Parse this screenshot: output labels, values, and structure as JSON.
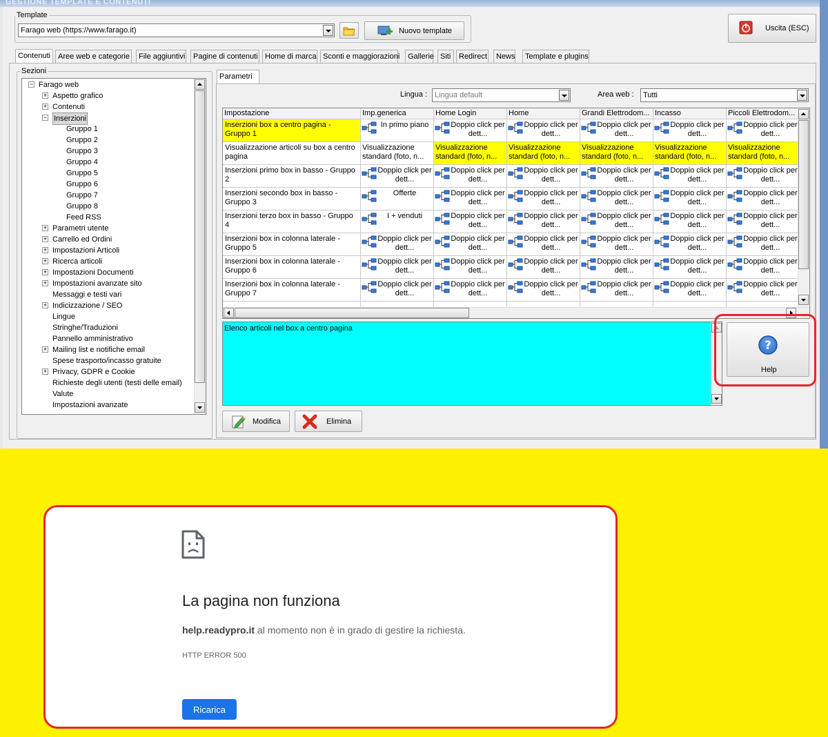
{
  "window": {
    "title": "GESTIONE TEMPLATE E CONTENUTI"
  },
  "template": {
    "group_label": "Template",
    "selected": "Farago web (https://www.farago.it)",
    "new_button": "Nuovo template",
    "exit_button": "Uscita (ESC)"
  },
  "tabs": [
    "Contenuti",
    "Aree web e categorie",
    "File aggiuntivi",
    "Pagine di contenuti",
    "Home di marca",
    "Sconti e maggiorazioni",
    "Gallerie",
    "Siti",
    "Redirect",
    "News",
    "Template e plugins"
  ],
  "sections": {
    "label": "Sezioni",
    "tree": [
      {
        "label": "Farago web",
        "level": 0,
        "expander": "−"
      },
      {
        "label": "Aspetto grafico",
        "level": 1,
        "expander": "+"
      },
      {
        "label": "Contenuti",
        "level": 1,
        "expander": "+"
      },
      {
        "label": "Inserzioni",
        "level": 1,
        "expander": "−",
        "selected": true
      },
      {
        "label": "Gruppo 1",
        "level": 2
      },
      {
        "label": "Gruppo 2",
        "level": 2
      },
      {
        "label": "Gruppo 3",
        "level": 2
      },
      {
        "label": "Gruppo 4",
        "level": 2
      },
      {
        "label": "Gruppo 5",
        "level": 2
      },
      {
        "label": "Gruppo 6",
        "level": 2
      },
      {
        "label": "Gruppo 7",
        "level": 2
      },
      {
        "label": "Gruppo 8",
        "level": 2
      },
      {
        "label": "Feed RSS",
        "level": 2
      },
      {
        "label": "Parametri utente",
        "level": 1,
        "expander": "+"
      },
      {
        "label": "Carrello ed Ordini",
        "level": 1,
        "expander": "+"
      },
      {
        "label": "Impostazioni Articoli",
        "level": 1,
        "expander": "+"
      },
      {
        "label": "Ricerca articoli",
        "level": 1,
        "expander": "+"
      },
      {
        "label": "Impostazioni Documenti",
        "level": 1,
        "expander": "+"
      },
      {
        "label": "Impostazioni avanzate sito",
        "level": 1,
        "expander": "+"
      },
      {
        "label": "Messaggi e testi vari",
        "level": 1
      },
      {
        "label": "Indicizzazione / SEO",
        "level": 1,
        "expander": "+"
      },
      {
        "label": "Lingue",
        "level": 1
      },
      {
        "label": "Stringhe/Traduzioni",
        "level": 1
      },
      {
        "label": "Pannello amministrativo",
        "level": 1
      },
      {
        "label": "Mailing list e notifiche email",
        "level": 1,
        "expander": "+"
      },
      {
        "label": "Spese trasporto/incasso gratuite",
        "level": 1
      },
      {
        "label": "Privacy, GDPR e Cookie",
        "level": 1,
        "expander": "+"
      },
      {
        "label": "Richieste degli utenti (testi delle email)",
        "level": 1
      },
      {
        "label": "Valute",
        "level": 1
      },
      {
        "label": "Impostazioni avanzate",
        "level": 1
      }
    ]
  },
  "params": {
    "tab": "Parametri",
    "lingua_label": "Lingua :",
    "lingua_value": "Lingua default",
    "area_label": "Area web :",
    "area_value": "Tutti",
    "columns": [
      "Impostazione",
      "Imp.generica",
      "Home Login",
      "Home",
      "Grandi Elettrodom...",
      "Incasso",
      "Piccoli Elettrodom..."
    ],
    "rows": [
      {
        "name": "Inserzioni box a centro pagina - Gruppo 1",
        "highlight": true,
        "generic": "In primo piano",
        "values": [
          "Doppio click per dett...",
          "Doppio click per dett...",
          "Doppio click per dett...",
          "Doppio click per dett...",
          "Doppio click per dett..."
        ]
      },
      {
        "name": "Visualizzazione articoli su box a centro pagina",
        "generic": "Visualizzazione standard (foto, n...",
        "generic_plain": true,
        "values_yellow": true,
        "values": [
          "Visualizzazione standard (foto, n...",
          "Visualizzazione standard (foto, n...",
          "Visualizzazione standard (foto, n...",
          "Visualizzazione standard (foto, n...",
          "Visualizzazione standard (foto, n..."
        ]
      },
      {
        "name": "Inserzioni primo box in basso - Gruppo 2",
        "generic": "Doppio click per dett...",
        "values": [
          "Doppio click per dett...",
          "Doppio click per dett...",
          "Doppio click per dett...",
          "Doppio click per dett...",
          "Doppio click per dett..."
        ]
      },
      {
        "name": "Inserzioni secondo box in basso - Gruppo 3",
        "generic": "Offerte",
        "values": [
          "Doppio click per dett...",
          "Doppio click per dett...",
          "Doppio click per dett...",
          "Doppio click per dett...",
          "Doppio click per dett..."
        ]
      },
      {
        "name": "Inserzioni terzo box in basso - Gruppo 4",
        "generic": "I + venduti",
        "values": [
          "Doppio click per dett...",
          "Doppio click per dett...",
          "Doppio click per dett...",
          "Doppio click per dett...",
          "Doppio click per dett..."
        ]
      },
      {
        "name": "Inserzioni box in colonna laterale - Gruppo 5",
        "generic": "Doppio click per dett...",
        "values": [
          "Doppio click per dett...",
          "Doppio click per dett...",
          "Doppio click per dett...",
          "Doppio click per dett...",
          "Doppio click per dett..."
        ]
      },
      {
        "name": "Inserzioni box in colonna laterale - Gruppo 6",
        "generic": "Doppio click per dett...",
        "values": [
          "Doppio click per dett...",
          "Doppio click per dett...",
          "Doppio click per dett...",
          "Doppio click per dett...",
          "Doppio click per dett..."
        ]
      },
      {
        "name": "Inserzioni box in colonna laterale - Gruppo 7",
        "generic": "Doppio click per dett...",
        "values": [
          "Doppio click per dett...",
          "Doppio click per dett...",
          "Doppio click per dett...",
          "Doppio click per dett...",
          "Doppio click per dett..."
        ]
      }
    ],
    "description": "Elenco articoli nel box a centro pagina",
    "help_button": "Help",
    "edit_button": "Modifica",
    "delete_button": "Elimina"
  },
  "error_page": {
    "title": "La pagina non funziona",
    "host": "help.readypro.it",
    "message": " al momento non è in grado di gestire la richiesta.",
    "code": "HTTP ERROR 500",
    "reload_button": "Ricarica"
  },
  "colors": {
    "highlight_yellow": "#ffff00",
    "memo_cyan": "#00ffff",
    "annotation_red": "#e8232a",
    "background_yellow": "#fff200",
    "button_blue": "#1a73e8"
  }
}
